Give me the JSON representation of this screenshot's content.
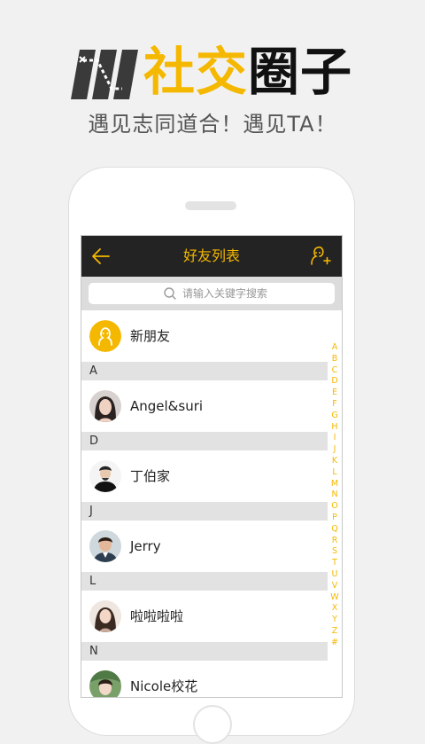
{
  "promo": {
    "title_part1": "社交",
    "title_part2": "圈子",
    "subtitle": "遇见志同道合！遇见TA！"
  },
  "header": {
    "title": "好友列表",
    "back_icon": "back-arrow-icon",
    "add_icon": "add-friend-icon"
  },
  "search": {
    "placeholder": "请输入关键字搜索"
  },
  "new_friends": {
    "label": "新朋友"
  },
  "sections": [
    {
      "letter": "A",
      "contacts": [
        {
          "name": "Angel&suri"
        }
      ]
    },
    {
      "letter": "D",
      "contacts": [
        {
          "name": "丁伯家"
        }
      ]
    },
    {
      "letter": "J",
      "contacts": [
        {
          "name": "Jerry"
        }
      ]
    },
    {
      "letter": "L",
      "contacts": [
        {
          "name": "啦啦啦啦"
        }
      ]
    },
    {
      "letter": "N",
      "contacts": [
        {
          "name": "Nicole校花"
        }
      ]
    }
  ],
  "index_letters": [
    "A",
    "B",
    "C",
    "D",
    "E",
    "F",
    "G",
    "H",
    "I",
    "J",
    "K",
    "L",
    "M",
    "N",
    "O",
    "P",
    "Q",
    "R",
    "S",
    "T",
    "U",
    "V",
    "W",
    "X",
    "Y",
    "Z",
    "#"
  ],
  "colors": {
    "accent": "#f5b800",
    "appbar": "#232323",
    "section_bg": "#e2e2e2"
  }
}
